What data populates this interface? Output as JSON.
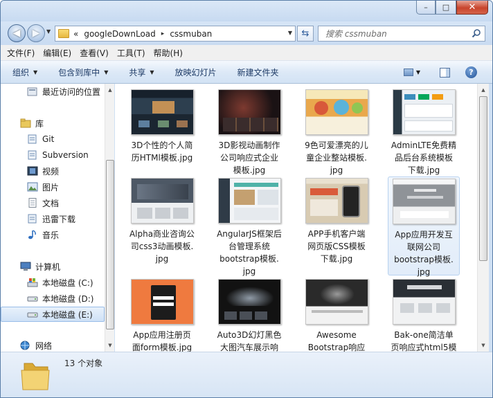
{
  "window": {
    "caption_min": "–",
    "caption_max": "□",
    "caption_close": "✕"
  },
  "address": {
    "recent_glyph": "«",
    "crumbs": [
      "googleDownLoad",
      "cssmuban"
    ],
    "sep": "▸",
    "dropdown": "▼"
  },
  "search": {
    "placeholder": "搜索 cssmuban"
  },
  "menu": [
    "文件(F)",
    "编辑(E)",
    "查看(V)",
    "工具(T)",
    "帮助(H)"
  ],
  "toolbar": {
    "organize": "组织",
    "include": "包含到库中",
    "share": "共享",
    "slideshow": "放映幻灯片",
    "new_folder": "新建文件夹",
    "dd": "▼"
  },
  "nav": {
    "recent": "最近访问的位置",
    "libraries": "库",
    "git": "Git",
    "svn": "Subversion",
    "videos": "视频",
    "pictures": "图片",
    "documents": "文档",
    "thunder": "迅雷下载",
    "music": "音乐",
    "computer": "计算机",
    "drive_c": "本地磁盘 (C:)",
    "drive_d": "本地磁盘 (D:)",
    "drive_e": "本地磁盘 (E:)",
    "network": "网络"
  },
  "files": [
    {
      "name": "3D个性的个人简历HTMl模板.jpg",
      "lines": [
        "3D个性的个人简",
        "历HTMl模板.jpg"
      ]
    },
    {
      "name": "3D影视动画制作公司响应式企业模板.jpg",
      "lines": [
        "3D影视动画制作",
        "公司响应式企业",
        "模板.jpg"
      ]
    },
    {
      "name": "9色可爱漂亮的儿童企业整站模板.jpg",
      "lines": [
        "9色可爱漂亮的儿",
        "童企业整站模板.",
        "jpg"
      ]
    },
    {
      "name": "AdminLTE免费精品后台系统模板下载.jpg",
      "lines": [
        "AdminLTE免费精",
        "品后台系统模板",
        "下载.jpg"
      ]
    },
    {
      "name": "Alpha商业咨询公司css3动画模板.jpg",
      "lines": [
        "Alpha商业咨询公",
        "司css3动画模板.",
        "jpg"
      ]
    },
    {
      "name": "AngularJS框架后台管理系统bootstrap模板.jpg",
      "lines": [
        "AngularJS框架后",
        "台管理系统",
        "bootstrap模板.",
        "jpg"
      ]
    },
    {
      "name": "APP手机客户端网页版CSS模板下载.jpg",
      "lines": [
        "APP手机客户端",
        "网页版CSS模板",
        "下载.jpg"
      ]
    },
    {
      "name": "App应用开发互联网公司bootstrap模板.jpg",
      "lines": [
        "App应用开发互",
        "联网公司",
        "bootstrap模板.",
        "jpg"
      ]
    },
    {
      "name": "App应用注册页面form模板.jpg",
      "lines": [
        "App应用注册页",
        "面form模板.jpg"
      ]
    },
    {
      "name": "Auto3D幻灯黑色大图汽车展示响",
      "lines": [
        "Auto3D幻灯黑色",
        "大图汽车展示响"
      ]
    },
    {
      "name": "Awesome Bootstrap响应",
      "lines": [
        "Awesome",
        "Bootstrap响应"
      ]
    },
    {
      "name": "Bak-one简洁单页响应式html5模",
      "lines": [
        "Bak-one简洁单",
        "页响应式html5模"
      ]
    }
  ],
  "status": {
    "count": "13 个对象"
  },
  "colors": {
    "accent": "#3a6ea5",
    "selection": "#cfe1f6",
    "close": "#c8442c"
  }
}
